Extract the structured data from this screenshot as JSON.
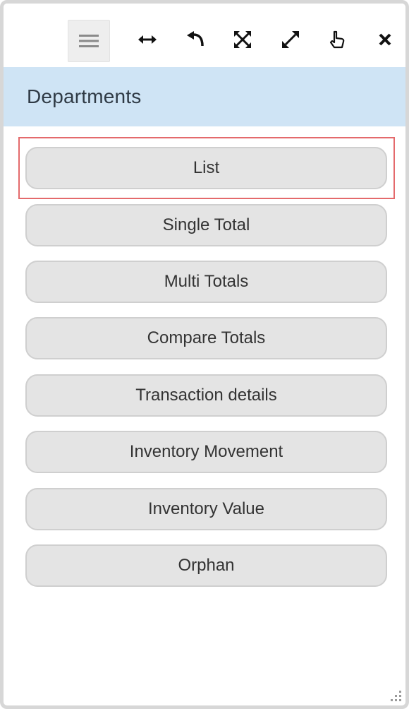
{
  "toolbar": {
    "icons": [
      "menu-icon",
      "horizontal-arrows-icon",
      "undo-arrow-icon",
      "collapse-icon",
      "expand-icon",
      "pointer-hand-icon",
      "close-icon"
    ]
  },
  "header": {
    "title": "Departments"
  },
  "menu": {
    "selected_index": 0,
    "items": [
      {
        "label": "List"
      },
      {
        "label": "Single Total"
      },
      {
        "label": "Multi Totals"
      },
      {
        "label": "Compare Totals"
      },
      {
        "label": "Transaction details"
      },
      {
        "label": "Inventory Movement"
      },
      {
        "label": "Inventory Value"
      },
      {
        "label": "Orphan"
      }
    ]
  },
  "colors": {
    "header_bg": "#cfe4f5",
    "selection_outline": "#e46a6c",
    "button_bg": "#e4e4e4"
  }
}
